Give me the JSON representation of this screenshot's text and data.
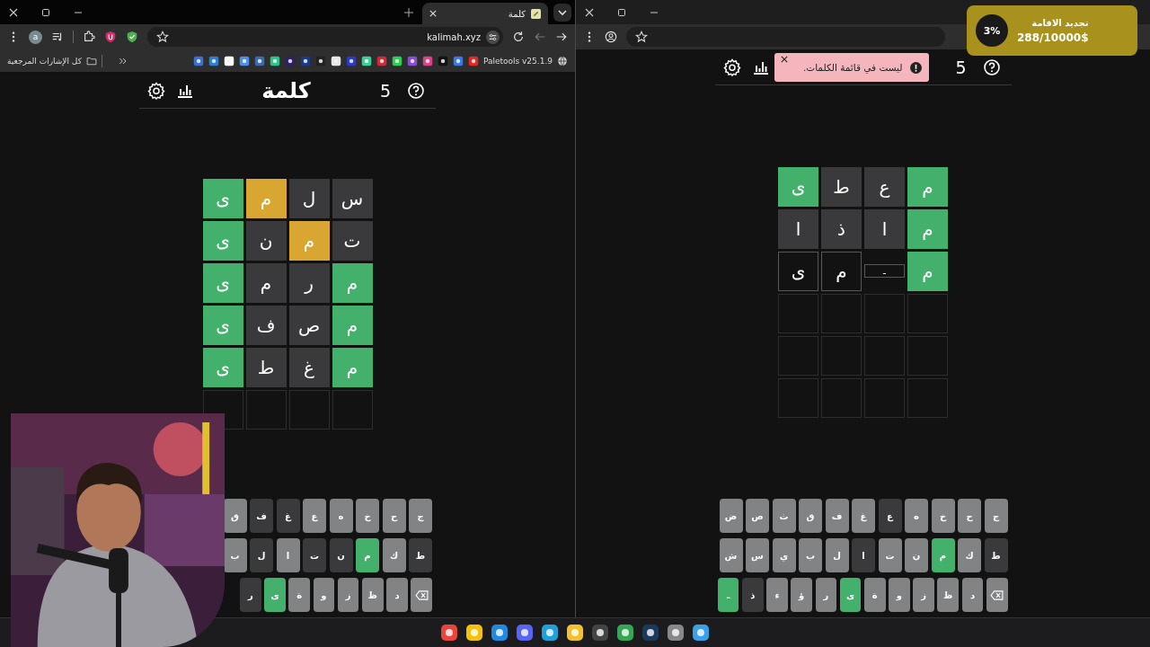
{
  "left_window": {
    "tab": {
      "title": "كلمة"
    },
    "profile_initial": "a",
    "address": "kalimah.xyz",
    "bookmarks": {
      "folder": "كل الإشارات المرجعية",
      "extension": "Paletools v25.1.9"
    },
    "page": {
      "title": "كلمة",
      "count": "5",
      "board": [
        [
          {
            "letter": "س",
            "kind": "absent"
          },
          {
            "letter": "ل",
            "kind": "absent"
          },
          {
            "letter": "م",
            "kind": "present"
          },
          {
            "letter": "ى",
            "kind": "correct"
          }
        ],
        [
          {
            "letter": "ت",
            "kind": "absent"
          },
          {
            "letter": "م",
            "kind": "present"
          },
          {
            "letter": "ن",
            "kind": "absent"
          },
          {
            "letter": "ى",
            "kind": "correct"
          }
        ],
        [
          {
            "letter": "م",
            "kind": "correct"
          },
          {
            "letter": "ر",
            "kind": "absent"
          },
          {
            "letter": "م",
            "kind": "absent"
          },
          {
            "letter": "ى",
            "kind": "correct"
          }
        ],
        [
          {
            "letter": "م",
            "kind": "correct"
          },
          {
            "letter": "ص",
            "kind": "absent"
          },
          {
            "letter": "ف",
            "kind": "absent"
          },
          {
            "letter": "ى",
            "kind": "correct"
          }
        ],
        [
          {
            "letter": "م",
            "kind": "correct"
          },
          {
            "letter": "غ",
            "kind": "absent"
          },
          {
            "letter": "ط",
            "kind": "absent"
          },
          {
            "letter": "ى",
            "kind": "correct"
          }
        ],
        [
          {
            "kind": "empty"
          },
          {
            "kind": "empty"
          },
          {
            "kind": "empty"
          },
          {
            "kind": "empty"
          }
        ]
      ],
      "keyboard": [
        [
          {
            "label": "ج",
            "kind": "unused"
          },
          {
            "label": "ح",
            "kind": "unused"
          },
          {
            "label": "خ",
            "kind": "unused"
          },
          {
            "label": "ه",
            "kind": "unused"
          },
          {
            "label": "ع",
            "kind": "unused"
          },
          {
            "label": "غ",
            "kind": "absent"
          },
          {
            "label": "ف",
            "kind": "absent"
          },
          {
            "label": "ق",
            "kind": "unused"
          }
        ],
        [
          {
            "label": "ط",
            "kind": "absent"
          },
          {
            "label": "ك",
            "kind": "unused"
          },
          {
            "label": "م",
            "kind": "correct"
          },
          {
            "label": "ن",
            "kind": "absent"
          },
          {
            "label": "ت",
            "kind": "absent"
          },
          {
            "label": "ا",
            "kind": "unused"
          },
          {
            "label": "ل",
            "kind": "absent"
          },
          {
            "label": "ب",
            "kind": "unused"
          }
        ],
        [
          {
            "kind": "backspace"
          },
          {
            "label": "د",
            "kind": "unused"
          },
          {
            "label": "ظ",
            "kind": "unused"
          },
          {
            "label": "ز",
            "kind": "unused"
          },
          {
            "label": "و",
            "kind": "unused"
          },
          {
            "label": "ة",
            "kind": "unused"
          },
          {
            "label": "ى",
            "kind": "correct"
          },
          {
            "label": "ر",
            "kind": "absent"
          }
        ]
      ]
    }
  },
  "right_window": {
    "page": {
      "count": "5",
      "toast": {
        "message": "ليست في قائمة الكلمات."
      },
      "board": [
        [
          {
            "letter": "م",
            "kind": "correct"
          },
          {
            "letter": "ع",
            "kind": "absent"
          },
          {
            "letter": "ط",
            "kind": "absent"
          },
          {
            "letter": "ى",
            "kind": "correct"
          }
        ],
        [
          {
            "letter": "م",
            "kind": "correct"
          },
          {
            "letter": "ا",
            "kind": "absent"
          },
          {
            "letter": "ذ",
            "kind": "absent"
          },
          {
            "letter": "ا",
            "kind": "absent"
          }
        ],
        [
          {
            "letter": "م",
            "kind": "correct"
          },
          {
            "letter": "ـ",
            "kind": "typing"
          },
          {
            "letter": "م",
            "kind": "filled"
          },
          {
            "letter": "ى",
            "kind": "filled"
          }
        ],
        [
          {
            "kind": "empty"
          },
          {
            "kind": "empty"
          },
          {
            "kind": "empty"
          },
          {
            "kind": "empty"
          }
        ],
        [
          {
            "kind": "empty"
          },
          {
            "kind": "empty"
          },
          {
            "kind": "empty"
          },
          {
            "kind": "empty"
          }
        ],
        [
          {
            "kind": "empty"
          },
          {
            "kind": "empty"
          },
          {
            "kind": "empty"
          },
          {
            "kind": "empty"
          }
        ]
      ],
      "keyboard": [
        [
          {
            "label": "ج",
            "kind": "unused"
          },
          {
            "label": "ح",
            "kind": "unused"
          },
          {
            "label": "خ",
            "kind": "unused"
          },
          {
            "label": "ه",
            "kind": "unused"
          },
          {
            "label": "ع",
            "kind": "absent"
          },
          {
            "label": "غ",
            "kind": "unused"
          },
          {
            "label": "ف",
            "kind": "unused"
          },
          {
            "label": "ق",
            "kind": "unused"
          },
          {
            "label": "ث",
            "kind": "unused"
          },
          {
            "label": "ص",
            "kind": "unused"
          },
          {
            "label": "ض",
            "kind": "unused"
          }
        ],
        [
          {
            "label": "ط",
            "kind": "absent"
          },
          {
            "label": "ك",
            "kind": "unused"
          },
          {
            "label": "م",
            "kind": "correct"
          },
          {
            "label": "ن",
            "kind": "unused"
          },
          {
            "label": "ت",
            "kind": "unused"
          },
          {
            "label": "ا",
            "kind": "absent"
          },
          {
            "label": "ل",
            "kind": "unused"
          },
          {
            "label": "ب",
            "kind": "unused"
          },
          {
            "label": "ي",
            "kind": "unused"
          },
          {
            "label": "س",
            "kind": "unused"
          },
          {
            "label": "ش",
            "kind": "unused"
          }
        ],
        [
          {
            "kind": "backspace"
          },
          {
            "label": "د",
            "kind": "unused"
          },
          {
            "label": "ظ",
            "kind": "unused"
          },
          {
            "label": "ز",
            "kind": "unused"
          },
          {
            "label": "و",
            "kind": "unused"
          },
          {
            "label": "ة",
            "kind": "unused"
          },
          {
            "label": "ى",
            "kind": "correct"
          },
          {
            "label": "ر",
            "kind": "unused"
          },
          {
            "label": "ؤ",
            "kind": "unused"
          },
          {
            "label": "ء",
            "kind": "unused"
          },
          {
            "label": "ذ",
            "kind": "absent"
          },
          {
            "label": "ـ",
            "kind": "correct"
          }
        ]
      ]
    }
  },
  "donation": {
    "percent": "3%",
    "title": "تجديد الاقامة",
    "amount": "288/10000$"
  }
}
